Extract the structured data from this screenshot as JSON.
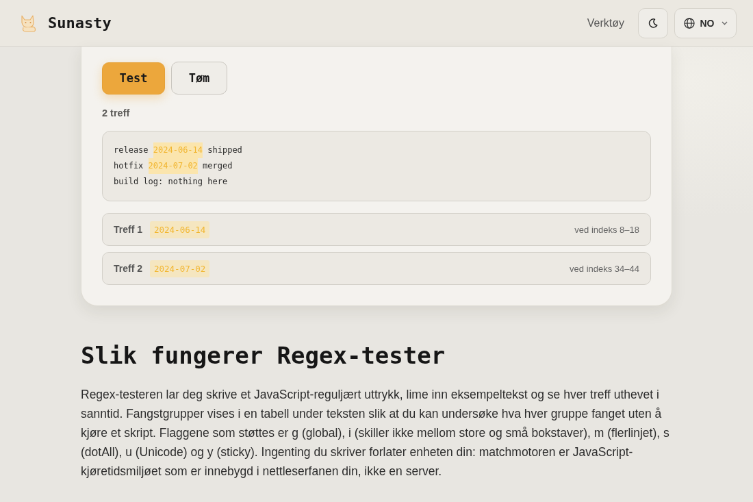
{
  "header": {
    "logo_text": "Sunasty",
    "nav_link": "Verktøy",
    "language": "NO"
  },
  "tester": {
    "buttons": [
      {
        "label": "Test",
        "kind": "primary"
      },
      {
        "label": "Tøm",
        "kind": "secondary"
      }
    ],
    "match_count": "2 treff",
    "sample_lines": [
      {
        "segments": [
          {
            "text": "release ",
            "highlight": false
          },
          {
            "text": "2024-06-14",
            "highlight": true
          },
          {
            "text": " shipped",
            "highlight": false
          }
        ]
      },
      {
        "segments": [
          {
            "text": "hotfix ",
            "highlight": false
          },
          {
            "text": "2024-07-02",
            "highlight": true
          },
          {
            "text": " merged",
            "highlight": false
          }
        ]
      },
      {
        "segments": [
          {
            "text": "build log: nothing here",
            "highlight": false
          }
        ]
      }
    ],
    "matches": [
      {
        "label": "Treff 1",
        "value": "2024-06-14",
        "position": "ved indeks 8–18"
      },
      {
        "label": "Treff 2",
        "value": "2024-07-02",
        "position": "ved indeks 34–44"
      }
    ]
  },
  "article": {
    "heading": "Slik fungerer Regex-tester",
    "paragraphs": [
      "Regex-testeren lar deg skrive et JavaScript-reguljært uttrykk, lime inn eksempeltekst og se hver treff uthevet i sanntid. Fangstgrupper vises i en tabell under teksten slik at du kan undersøke hva hver gruppe fanget uten å kjøre et skript. Flaggene som støttes er g (global), i (skiller ikke mellom store og små bokstaver), m (flerlinjet), s (dotAll), u (Unicode) og y (sticky). Ingenting du skriver forlater enheten din: matchmotoren er JavaScript-kjøretidsmiljøet som er innebygd i nettleserfanen din, ikke en server."
    ]
  }
}
